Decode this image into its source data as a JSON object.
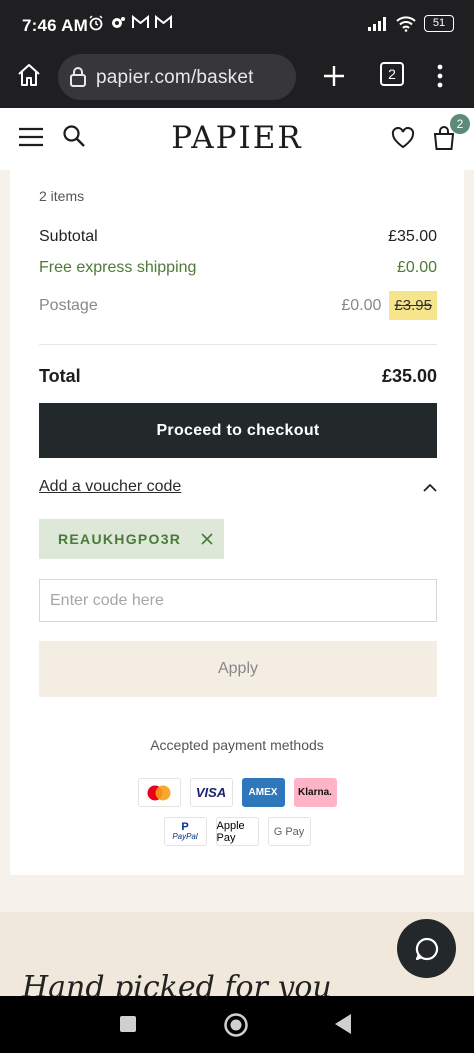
{
  "status_bar": {
    "time": "7:46 AM",
    "battery": "51"
  },
  "browser": {
    "url": "papier.com/basket",
    "tab_count": "2"
  },
  "site": {
    "logo": "PAPIER",
    "basket_count": "2"
  },
  "summary": {
    "items_count": "2 items",
    "subtotal_label": "Subtotal",
    "subtotal_value": "£35.00",
    "shipping_label": "Free express shipping",
    "shipping_value": "£0.00",
    "postage_label": "Postage",
    "postage_value": "£0.00",
    "postage_original": "£3.95",
    "total_label": "Total",
    "total_value": "£35.00",
    "checkout_label": "Proceed to checkout"
  },
  "voucher": {
    "link_label": "Add a voucher code",
    "applied_code": "REAUKHGPO3R",
    "input_placeholder": "Enter code here",
    "apply_label": "Apply"
  },
  "payment": {
    "title": "Accepted payment methods",
    "methods": [
      "mastercard",
      "VISA",
      "AMEX",
      "Klarna.",
      "PayPal",
      "Apple Pay",
      "G Pay"
    ]
  },
  "recommendations": {
    "heading": "Hand picked for you"
  },
  "colors": {
    "accent_green": "#4d7a36",
    "checkout_bg": "#23292a",
    "highlight_yellow": "#f6e58a",
    "badge_teal": "#5e8a78"
  }
}
